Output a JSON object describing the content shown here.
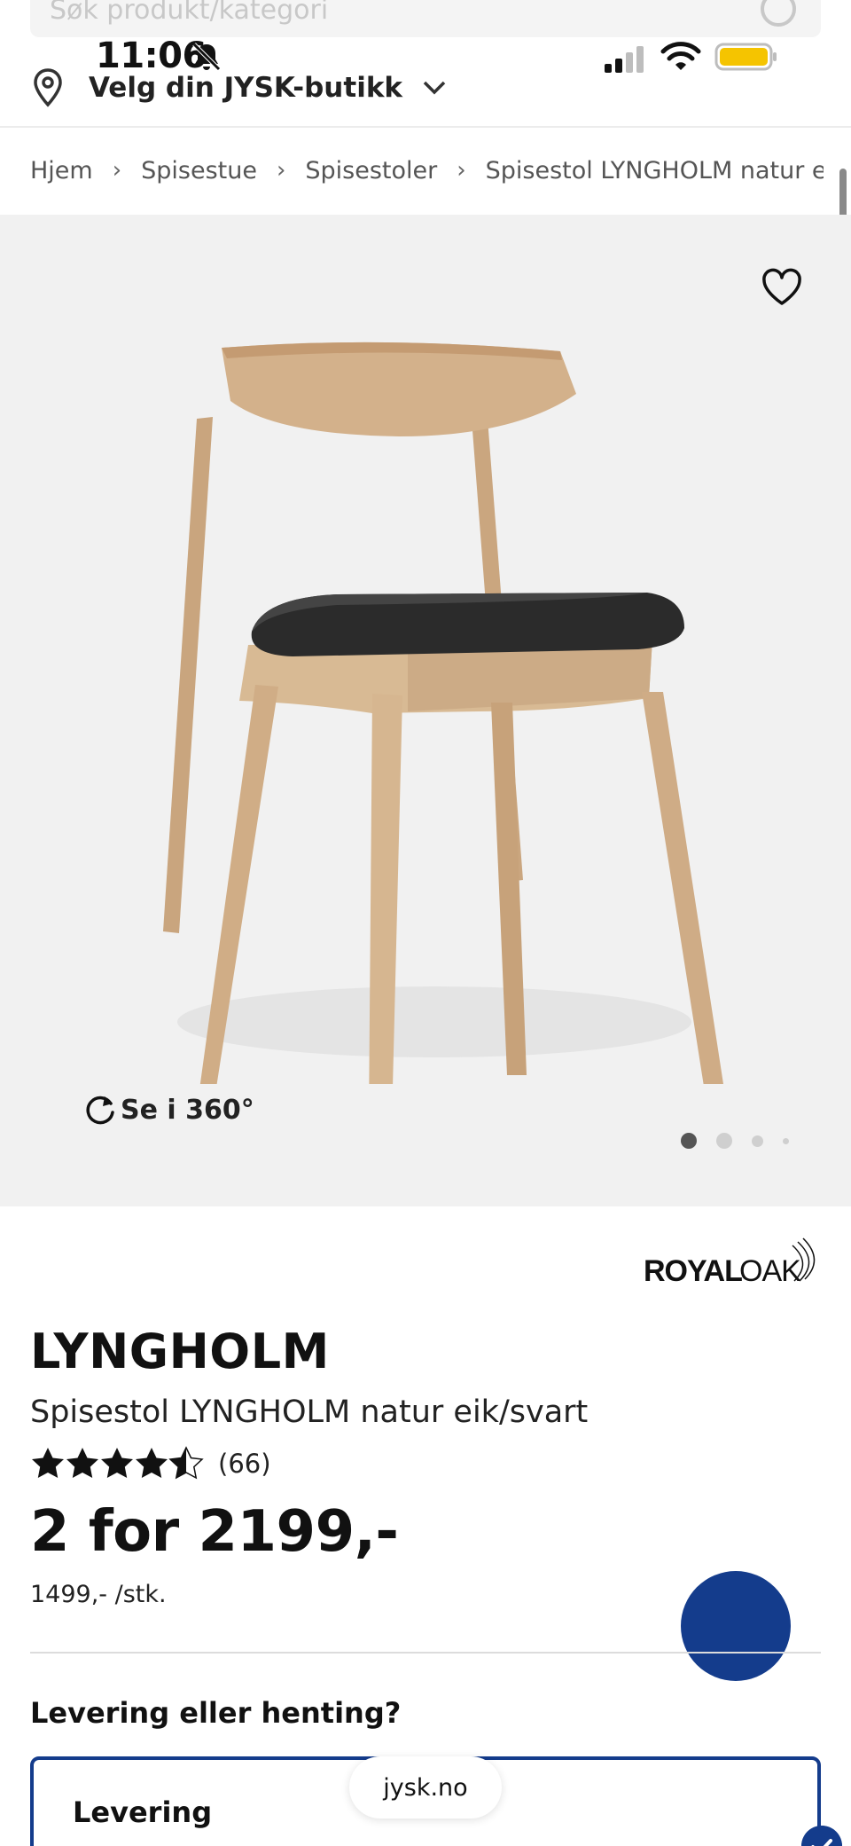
{
  "status_bar": {
    "time": "11:06"
  },
  "search": {
    "placeholder": "Søk produkt/kategori"
  },
  "store_selector": {
    "label": "Velg din JYSK-butikk"
  },
  "breadcrumb": [
    "Hjem",
    "Spisestue",
    "Spisestoler",
    "Spisestol LYNGHOLM natur eik/svart"
  ],
  "gallery": {
    "view360_label": "Se i 360°",
    "slide_count": 4,
    "active_slide": 1
  },
  "product": {
    "brand": "ROYAL OAK",
    "title": "LYNGHOLM",
    "subtitle": "Spisestol LYNGHOLM natur eik/svart",
    "rating": 4.5,
    "rating_count": "(66)",
    "price": "2 for 2199,-",
    "unit_price": "1499,- /stk."
  },
  "delivery": {
    "question": "Levering eller henting?",
    "option_label": "Levering"
  },
  "browser": {
    "url": "jysk.no"
  },
  "colors": {
    "accent": "#143c8c",
    "gallery_bg": "#f1f1f1"
  }
}
